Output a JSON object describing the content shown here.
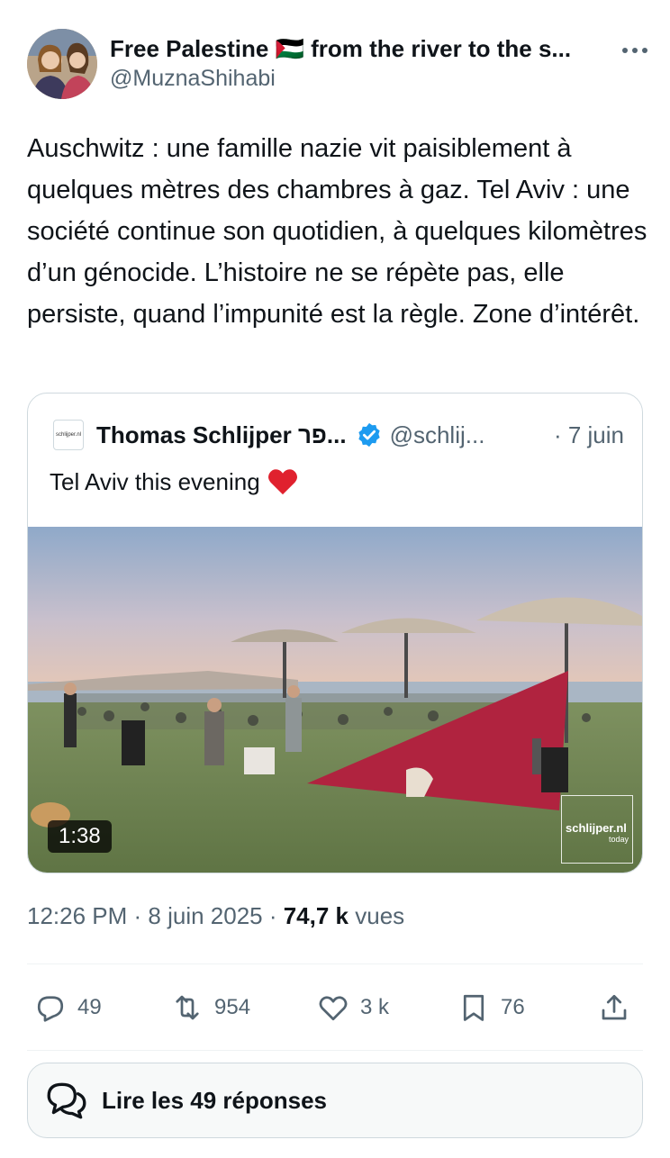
{
  "author": {
    "display_name": "Free Palestine 🇵🇸 from the river to the s...",
    "handle": "@MuznaShihabi"
  },
  "tweet": {
    "text": "Auschwitz : une famille nazie vit paisiblement à quelques mètres des chambres à gaz. Tel Aviv : une société continue son quotidien, à quelques kilomètres d’un génocide. L’histoire ne se répète pas, elle persiste, quand l’impunité est la règle. Zone d’intérêt."
  },
  "quoted": {
    "logo_text": "schlijper.nl",
    "display_name": "Thomas Schlijper פר...",
    "handle": "@schlij...",
    "date": "· 7 juin",
    "text": "Tel Aviv this evening",
    "video_duration": "1:38",
    "watermark": "schlijper.nl",
    "watermark_sub": "today"
  },
  "meta": {
    "time": "12:26 PM · 8 juin 2025 · ",
    "views_count": "74,7 k",
    "views_label": " vues"
  },
  "actions": {
    "replies": "49",
    "reposts": "954",
    "likes": "3 k",
    "bookmarks": "76"
  },
  "replies_button": {
    "label": "Lire les 49 réponses"
  },
  "colors": {
    "text_primary": "#0f1419",
    "text_secondary": "#536471",
    "verified_blue": "#1d9bf0",
    "heart_red": "#f4212e",
    "border": "#cfd9de"
  },
  "icons": [
    "more-icon",
    "verified-icon",
    "heart-emoji-icon",
    "reply-icon",
    "repost-icon",
    "like-icon",
    "bookmark-icon",
    "share-icon",
    "chat-bubbles-icon"
  ]
}
